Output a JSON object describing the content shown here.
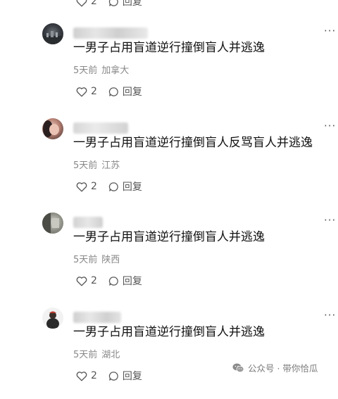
{
  "top_partial": {
    "likes": "2",
    "reply_label": "回复"
  },
  "comments": [
    {
      "text": "一男子占用盲道逆行撞倒盲人并逃逸",
      "time": "5天前",
      "location": "加拿大",
      "likes": "2",
      "reply_label": "回复",
      "more_label": "···"
    },
    {
      "text": "一男子占用盲道逆行撞倒盲人反骂盲人并逃逸",
      "time": "5天前",
      "location": "江苏",
      "likes": "2",
      "reply_label": "回复",
      "more_label": "···"
    },
    {
      "text": "一男子占用盲道逆行撞倒盲人并逃逸",
      "time": "5天前",
      "location": "陕西",
      "likes": "2",
      "reply_label": "回复",
      "more_label": "···"
    },
    {
      "text": "一男子占用盲道逆行撞倒盲人并逃逸",
      "time": "5天前",
      "location": "湖北",
      "likes": "2",
      "reply_label": "回复",
      "more_label": "···"
    }
  ],
  "watermark": {
    "text": "公众号 · 带你恰瓜"
  },
  "colors": {
    "text": "#111111",
    "meta": "#888888",
    "icon": "#555555"
  },
  "icons": {
    "like": "heart-icon",
    "reply": "comment-bubble-icon",
    "more": "more-dots-icon",
    "watermark": "wechat-icon"
  }
}
